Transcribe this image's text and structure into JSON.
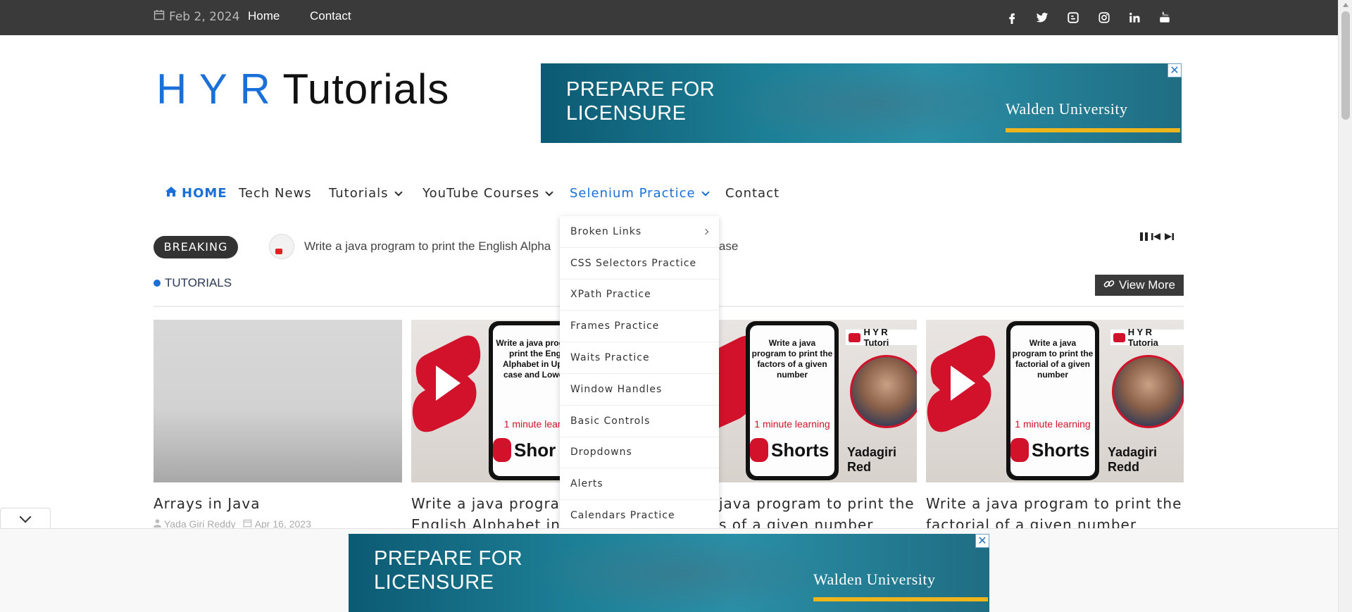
{
  "topbar": {
    "date": "Feb 2, 2024",
    "links": [
      "Home",
      "Contact"
    ],
    "social_icons": [
      "facebook-icon",
      "twitter-icon",
      "blogger-icon",
      "instagram-icon",
      "linkedin-icon",
      "youtube-icon"
    ]
  },
  "logo": {
    "part1": "H Y R",
    "part2": "Tutorials"
  },
  "ad": {
    "headline_line1": "PREPARE FOR",
    "headline_line2": "LICENSURE",
    "brand": "Walden University",
    "close": "✕"
  },
  "nav": {
    "items": [
      {
        "label": "HOME",
        "active": true
      },
      {
        "label": "Tech News"
      },
      {
        "label": "Tutorials",
        "has_dropdown": true
      },
      {
        "label": "YouTube Courses",
        "has_dropdown": true
      },
      {
        "label": "Selenium Practice",
        "has_dropdown": true,
        "open": true
      },
      {
        "label": "Contact"
      }
    ]
  },
  "dropdown": {
    "items": [
      {
        "label": "Broken Links",
        "has_submenu": true
      },
      {
        "label": "CSS Selectors Practice"
      },
      {
        "label": "XPath Practice"
      },
      {
        "label": "Frames Practice"
      },
      {
        "label": "Waits Practice"
      },
      {
        "label": "Window Handles"
      },
      {
        "label": "Basic Controls"
      },
      {
        "label": "Dropdowns"
      },
      {
        "label": "Alerts"
      },
      {
        "label": "Calendars Practice"
      }
    ]
  },
  "breaking": {
    "label": "BREAKING",
    "text_visible": "Write a java program to print the English Alpha",
    "text_tail": "r case"
  },
  "section": {
    "title": "TUTORIALS",
    "view_more": "View More"
  },
  "cards": [
    {
      "title": "Arrays in Java",
      "author": "Yada Giri Reddy",
      "date": "Apr 16, 2023"
    },
    {
      "title_line1": "Write a java program",
      "title_line2": "English Alphabet in",
      "thumb_text": "Write a java prog to print the Eng Alphabet in Upp case and Lower",
      "minute": "1 minute learn",
      "shorts": "Shor"
    },
    {
      "title_line1": "java program to print the",
      "title_line2": "s of a given number",
      "thumb_text": "Write a java program to print the factors of a given number",
      "minute": "1 minute learning",
      "shorts": "Shorts",
      "badge": "H Y R Tutori",
      "presenter": "Yadagiri Red"
    },
    {
      "title_line1": "Write a java program to print the",
      "title_line2": "factorial of a given number",
      "thumb_text": "Write a java program to print the factorial of a given number",
      "minute": "1 minute learning",
      "shorts": "Shorts",
      "badge": "H Y R Tutoria",
      "presenter": "Yadagiri Redd"
    }
  ],
  "colors": {
    "accent": "#1a6fd8",
    "topbar": "#3a3a3a",
    "youtube_red": "#d1122a",
    "ad_gold": "#f0b51b"
  }
}
